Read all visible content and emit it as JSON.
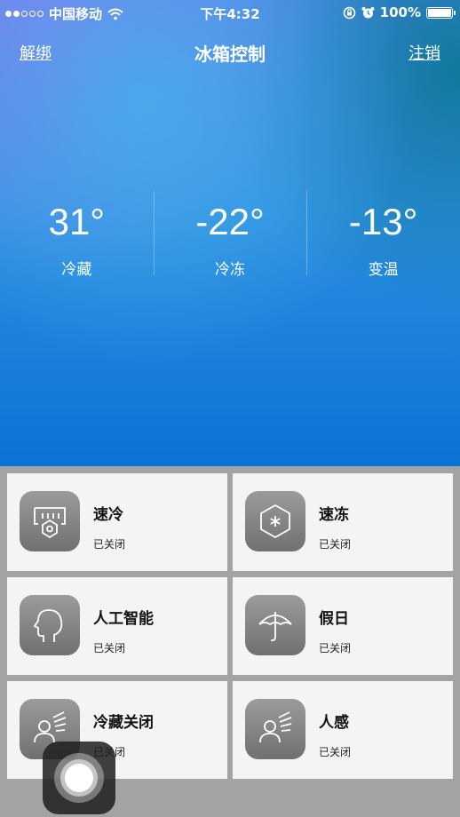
{
  "status_bar": {
    "carrier": "中国移动",
    "time": "下午4:32",
    "battery": "100%",
    "signal_bars_filled": 2,
    "signal_bars_total": 5
  },
  "nav": {
    "left_link": "解绑",
    "title": "冰箱控制",
    "right_link": "注销"
  },
  "temperatures": [
    {
      "value": "31°",
      "label": "冷藏"
    },
    {
      "value": "-22°",
      "label": "冷冻"
    },
    {
      "value": "-13°",
      "label": "变温"
    }
  ],
  "features": [
    {
      "name": "速冷",
      "status": "已关闭",
      "icon": "fast-cool-icon"
    },
    {
      "name": "速冻",
      "status": "已关闭",
      "icon": "fast-freeze-icon"
    },
    {
      "name": "人工智能",
      "status": "已关闭",
      "icon": "ai-head-icon"
    },
    {
      "name": "假日",
      "status": "已关闭",
      "icon": "umbrella-icon"
    },
    {
      "name": "冷藏关闭",
      "status": "已关闭",
      "icon": "person-wind-icon"
    },
    {
      "name": "人感",
      "status": "已关闭",
      "icon": "person-sense-icon"
    }
  ],
  "colors": {
    "hero_gradient_top": "#4f86e9",
    "hero_gradient_bottom": "#0a73d4",
    "grid_background": "#a3a3a3",
    "card_background": "#f4f4f4"
  }
}
